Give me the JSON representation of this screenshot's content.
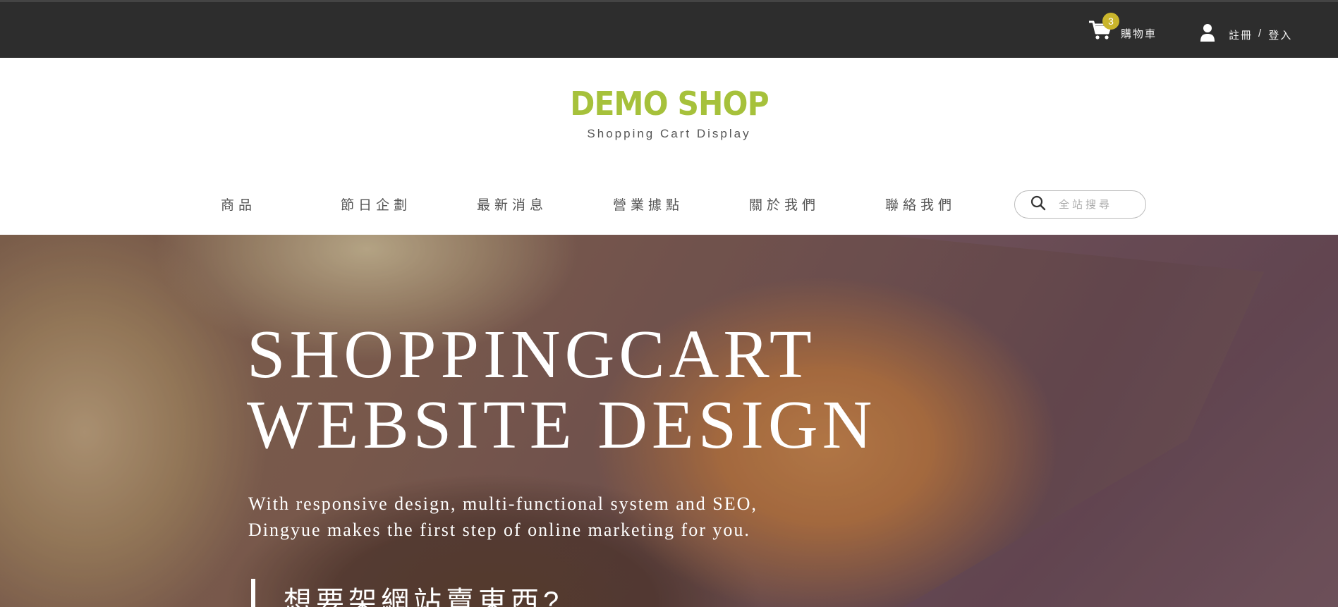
{
  "topbar": {
    "cart": {
      "count": "3",
      "label": "購物車",
      "icon": "cart-icon"
    },
    "account": {
      "icon": "user-icon",
      "register": "註冊",
      "separator": "/",
      "login": "登入"
    }
  },
  "header": {
    "logo": "DEMO SHOP",
    "tagline": "Shopping Cart Display",
    "brand_color": "#a6c13b"
  },
  "nav": {
    "items": [
      {
        "label": "商品"
      },
      {
        "label": "節日企劃"
      },
      {
        "label": "最新消息"
      },
      {
        "label": "營業據點"
      },
      {
        "label": "關於我們"
      },
      {
        "label": "聯絡我們"
      }
    ],
    "search": {
      "icon": "search-icon",
      "placeholder": "全站搜尋"
    }
  },
  "hero": {
    "title_line1": "SHOPPINGCART",
    "title_line2": "WEBSITE DESIGN",
    "subtitle_line1": "With responsive design, multi-functional system and SEO,",
    "subtitle_line2": "Dingyue makes the first step of online marketing for you.",
    "question": "想要架網站賣東西?"
  }
}
